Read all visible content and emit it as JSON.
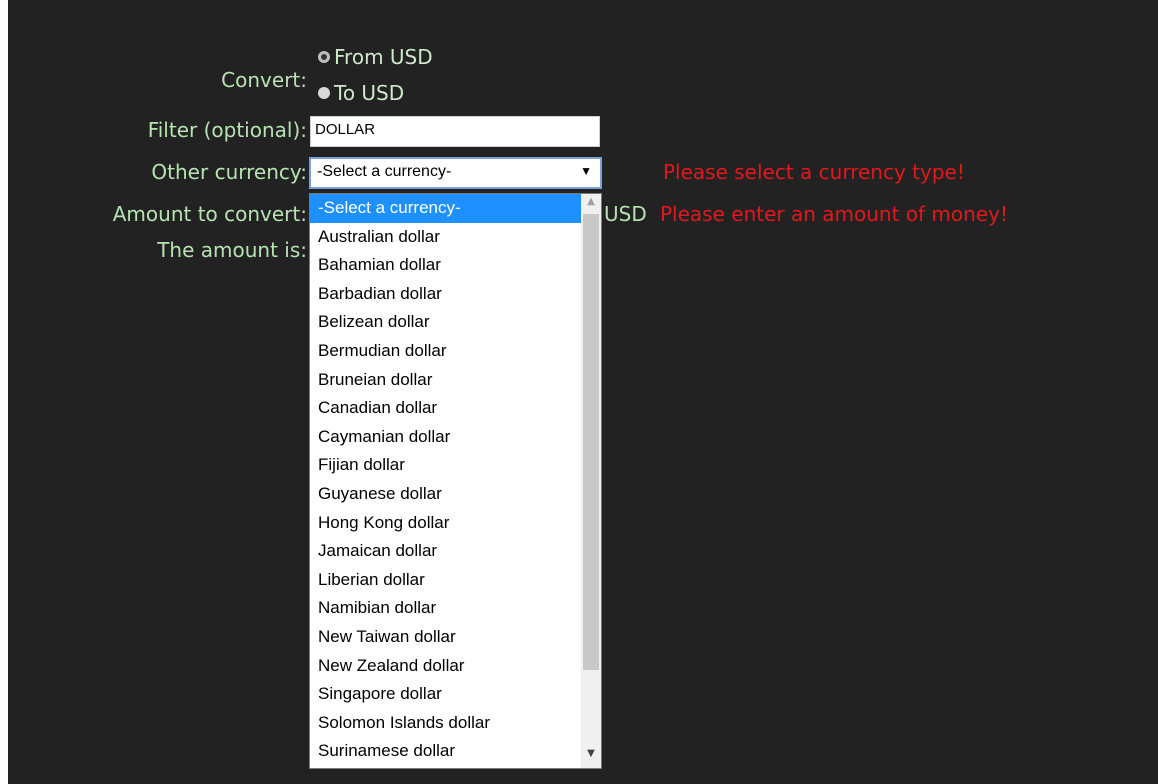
{
  "form": {
    "convert_label": "Convert:",
    "radio_from": "From USD",
    "radio_to": "To USD",
    "filter_label": "Filter (optional):",
    "filter_value": "DOLLAR",
    "other_currency_label": "Other currency:",
    "select_current": "-Select a currency-",
    "amount_label": "Amount to convert:",
    "amount_unit": "USD",
    "result_label": "The amount is:"
  },
  "errors": {
    "currency": "Please select a currency type!",
    "amount": "Please enter an amount of money!"
  },
  "options": [
    "-Select a currency-",
    "Australian dollar",
    "Bahamian dollar",
    "Barbadian dollar",
    "Belizean dollar",
    "Bermudian dollar",
    "Bruneian dollar",
    "Canadian dollar",
    "Caymanian dollar",
    "Fijian dollar",
    "Guyanese dollar",
    "Hong Kong dollar",
    "Jamaican dollar",
    "Liberian dollar",
    "Namibian dollar",
    "New Taiwan dollar",
    "New Zealand dollar",
    "Singapore dollar",
    "Solomon Islands dollar",
    "Surinamese dollar"
  ],
  "colors": {
    "background": "#222222",
    "label": "#b7e3b2",
    "error": "#e3171c",
    "selected_option": "#1e90ff"
  }
}
